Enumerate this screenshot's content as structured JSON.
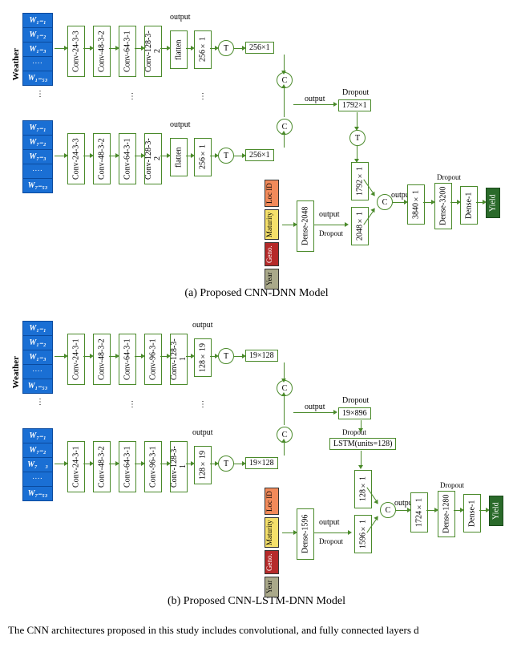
{
  "weather_label": "Weather",
  "w_group1": [
    "W₁₋₁",
    "W₁₋₂",
    "W₁₋₃",
    "W₁₋₅₃"
  ],
  "w_group2": [
    "W₇₋₁",
    "W₇₋₂",
    "W₇₋₃",
    "W₇₋₅₃"
  ],
  "w_group2_b": [
    "W₇₋₁",
    "W₇₋₂",
    "W₇ ₃",
    "W₇₋₅₃"
  ],
  "dots": "....",
  "model_a": {
    "convs": [
      "Conv-24-3-3",
      "Conv-48-3-2",
      "Conv-64-3-1",
      "Conv-128-3-2"
    ],
    "flatten": "flatten",
    "vec": "256×1",
    "concat1": "256×1",
    "dropout": "Dropout",
    "c_out": "1792×1",
    "feat_dense": "Dense-2048",
    "feat_out": "2048×1",
    "final_vec": "3840×1",
    "dense_final": [
      "Dense-3200",
      "Dense-1"
    ],
    "output": "output",
    "T": "T",
    "C": "C",
    "caption": "(a) Proposed CNN-DNN Model"
  },
  "model_b": {
    "convs": [
      "Conv-24-3-1",
      "Conv-48-3-2",
      "Conv-64-3-1",
      "Conv-96-3-1",
      "Conv-128-3-1"
    ],
    "vec": "128×19",
    "reshape": "19×128",
    "dropout": "Dropout",
    "c_out": "19×896",
    "lstm": "LSTM(units=128)",
    "lstm_out": "128×1",
    "feat_dense": "Dense-1596",
    "feat_out": "1596×1",
    "final_vec": "1724×1",
    "dense_final": [
      "Dense-1280",
      "Dense-1"
    ],
    "output": "output",
    "T": "T",
    "C": "C",
    "caption": "(b) Proposed CNN-LSTM-DNN Model"
  },
  "feat_labels": {
    "loc": "Loc ID",
    "mat": "Maturity",
    "gen": "Geno.",
    "yr": "Year"
  },
  "yield": "Yield",
  "footer": "The CNN architectures proposed in this study includes convolutional, and fully connected layers d"
}
